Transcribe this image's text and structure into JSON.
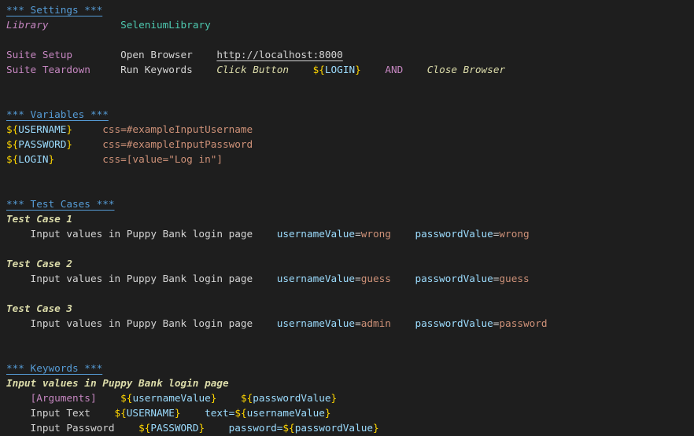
{
  "editor": {
    "lines": [
      [
        {
          "text": "*** Settings ***",
          "cls": "t-header"
        }
      ],
      [
        {
          "text": "Library",
          "cls": "t-setting-italic"
        },
        {
          "text": "            ",
          "cls": "t-plain"
        },
        {
          "text": "SeleniumLibrary",
          "cls": "t-library"
        }
      ],
      [],
      [
        {
          "text": "Suite Setup",
          "cls": "t-setting"
        },
        {
          "text": "        ",
          "cls": "t-plain"
        },
        {
          "text": "Open Browser",
          "cls": "t-keyword"
        },
        {
          "text": "    ",
          "cls": "t-plain"
        },
        {
          "text": "http://localhost:8000",
          "cls": "t-url"
        }
      ],
      [
        {
          "text": "Suite Teardown",
          "cls": "t-setting"
        },
        {
          "text": "     ",
          "cls": "t-plain"
        },
        {
          "text": "Run Keywords",
          "cls": "t-keyword"
        },
        {
          "text": "    ",
          "cls": "t-plain"
        },
        {
          "text": "Click Button",
          "cls": "t-keyword-italic"
        },
        {
          "text": "    ",
          "cls": "t-plain"
        },
        {
          "text": "${",
          "cls": "t-varbrace"
        },
        {
          "text": "LOGIN",
          "cls": "t-varname"
        },
        {
          "text": "}",
          "cls": "t-varbrace"
        },
        {
          "text": "    ",
          "cls": "t-plain"
        },
        {
          "text": "AND",
          "cls": "t-and"
        },
        {
          "text": "    ",
          "cls": "t-plain"
        },
        {
          "text": "Close Browser",
          "cls": "t-keyword-italic"
        }
      ],
      [],
      [],
      [
        {
          "text": "*** Variables ***",
          "cls": "t-header"
        }
      ],
      [
        {
          "text": "${",
          "cls": "t-varbrace"
        },
        {
          "text": "USERNAME",
          "cls": "t-varname"
        },
        {
          "text": "}",
          "cls": "t-varbrace"
        },
        {
          "text": "     ",
          "cls": "t-plain"
        },
        {
          "text": "css=#exampleInputUsername",
          "cls": "t-value"
        }
      ],
      [
        {
          "text": "${",
          "cls": "t-varbrace"
        },
        {
          "text": "PASSWORD",
          "cls": "t-varname"
        },
        {
          "text": "}",
          "cls": "t-varbrace"
        },
        {
          "text": "     ",
          "cls": "t-plain"
        },
        {
          "text": "css=#exampleInputPassword",
          "cls": "t-value"
        }
      ],
      [
        {
          "text": "${",
          "cls": "t-varbrace"
        },
        {
          "text": "LOGIN",
          "cls": "t-varname"
        },
        {
          "text": "}",
          "cls": "t-varbrace"
        },
        {
          "text": "        ",
          "cls": "t-plain"
        },
        {
          "text": "css=[value=\"Log in\"]",
          "cls": "t-value"
        }
      ],
      [],
      [],
      [
        {
          "text": "*** Test Cases ***",
          "cls": "t-header"
        }
      ],
      [
        {
          "text": "Test Case 1",
          "cls": "t-testname"
        }
      ],
      [
        {
          "text": "    Input values in Puppy Bank login page",
          "cls": "t-keyword"
        },
        {
          "text": "    ",
          "cls": "t-plain"
        },
        {
          "text": "usernameValue",
          "cls": "t-argname"
        },
        {
          "text": "=",
          "cls": "t-op"
        },
        {
          "text": "wrong",
          "cls": "t-value"
        },
        {
          "text": "    ",
          "cls": "t-plain"
        },
        {
          "text": "passwordValue",
          "cls": "t-argname"
        },
        {
          "text": "=",
          "cls": "t-op"
        },
        {
          "text": "wrong",
          "cls": "t-value"
        }
      ],
      [],
      [
        {
          "text": "Test Case 2",
          "cls": "t-testname"
        }
      ],
      [
        {
          "text": "    Input values in Puppy Bank login page",
          "cls": "t-keyword"
        },
        {
          "text": "    ",
          "cls": "t-plain"
        },
        {
          "text": "usernameValue",
          "cls": "t-argname"
        },
        {
          "text": "=",
          "cls": "t-op"
        },
        {
          "text": "guess",
          "cls": "t-value"
        },
        {
          "text": "    ",
          "cls": "t-plain"
        },
        {
          "text": "passwordValue",
          "cls": "t-argname"
        },
        {
          "text": "=",
          "cls": "t-op"
        },
        {
          "text": "guess",
          "cls": "t-value"
        }
      ],
      [],
      [
        {
          "text": "Test Case 3",
          "cls": "t-testname"
        }
      ],
      [
        {
          "text": "    Input values in Puppy Bank login page",
          "cls": "t-keyword"
        },
        {
          "text": "    ",
          "cls": "t-plain"
        },
        {
          "text": "usernameValue",
          "cls": "t-argname"
        },
        {
          "text": "=",
          "cls": "t-op"
        },
        {
          "text": "admin",
          "cls": "t-value"
        },
        {
          "text": "    ",
          "cls": "t-plain"
        },
        {
          "text": "passwordValue",
          "cls": "t-argname"
        },
        {
          "text": "=",
          "cls": "t-op"
        },
        {
          "text": "password",
          "cls": "t-value"
        }
      ],
      [],
      [],
      [
        {
          "text": "*** Keywords ***",
          "cls": "t-header"
        }
      ],
      [
        {
          "text": "Input values in Puppy Bank login page",
          "cls": "t-testname"
        }
      ],
      [
        {
          "text": "    ",
          "cls": "t-plain"
        },
        {
          "text": "[Arguments]",
          "cls": "t-bracket"
        },
        {
          "text": "    ",
          "cls": "t-plain"
        },
        {
          "text": "${",
          "cls": "t-varbrace"
        },
        {
          "text": "usernameValue",
          "cls": "t-varname"
        },
        {
          "text": "}",
          "cls": "t-varbrace"
        },
        {
          "text": "    ",
          "cls": "t-plain"
        },
        {
          "text": "${",
          "cls": "t-varbrace"
        },
        {
          "text": "passwordValue",
          "cls": "t-varname"
        },
        {
          "text": "}",
          "cls": "t-varbrace"
        }
      ],
      [
        {
          "text": "    Input Text",
          "cls": "t-keyword"
        },
        {
          "text": "    ",
          "cls": "t-plain"
        },
        {
          "text": "${",
          "cls": "t-varbrace"
        },
        {
          "text": "USERNAME",
          "cls": "t-varname"
        },
        {
          "text": "}",
          "cls": "t-varbrace"
        },
        {
          "text": "    ",
          "cls": "t-plain"
        },
        {
          "text": "text=",
          "cls": "t-argname"
        },
        {
          "text": "${",
          "cls": "t-varbrace"
        },
        {
          "text": "usernameValue",
          "cls": "t-varname"
        },
        {
          "text": "}",
          "cls": "t-varbrace"
        }
      ],
      [
        {
          "text": "    Input Password",
          "cls": "t-keyword"
        },
        {
          "text": "    ",
          "cls": "t-plain"
        },
        {
          "text": "${",
          "cls": "t-varbrace"
        },
        {
          "text": "PASSWORD",
          "cls": "t-varname"
        },
        {
          "text": "}",
          "cls": "t-varbrace"
        },
        {
          "text": "    ",
          "cls": "t-plain"
        },
        {
          "text": "password=",
          "cls": "t-argname"
        },
        {
          "text": "${",
          "cls": "t-varbrace"
        },
        {
          "text": "passwordValue",
          "cls": "t-varname"
        },
        {
          "text": "}",
          "cls": "t-varbrace"
        }
      ]
    ]
  },
  "colors": {
    "background": "#1e1e1e",
    "header": "#569cd6",
    "setting": "#c586c0",
    "library": "#4ec9b0",
    "variable_brace": "#ffd700",
    "variable_name": "#9cdcfe",
    "value": "#ce9178",
    "test_name": "#dcdcaa",
    "plain": "#d4d4d4"
  }
}
